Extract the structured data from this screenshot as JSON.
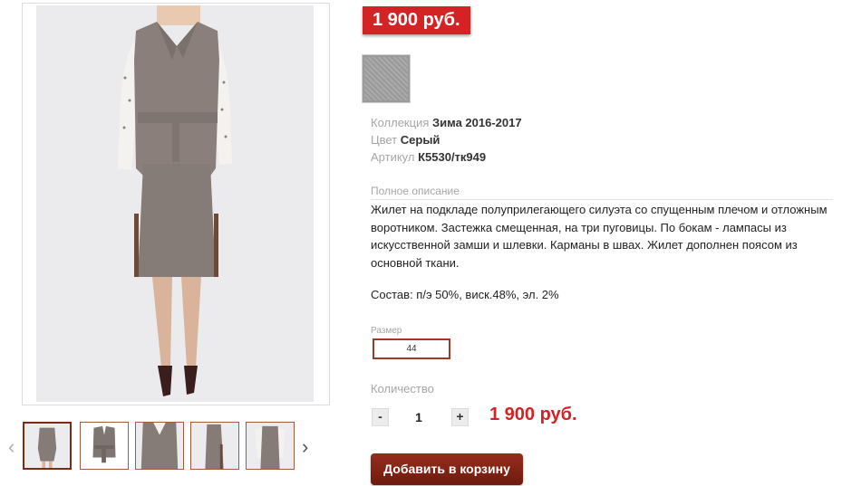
{
  "product": {
    "price_badge": "1 900 руб.",
    "collection": {
      "label": "Коллекция",
      "value": "Зима 2016-2017"
    },
    "color": {
      "label": "Цвет",
      "value": "Серый"
    },
    "article": {
      "label": "Артикул",
      "value": "К5530/тк949"
    },
    "description_label": "Полное описание",
    "description": "Жилет на подкладе полуприлегающего силуэта со спущенным плечом и отложным воротником. Застежка смещенная, на три пуговицы. По бокам - лампасы из искусственной замши и шлевки. Карманы в швах. Жилет дополнен поясом из основной ткани.",
    "composition": "Состав: п/э 50%, виск.48%, эл. 2%",
    "size_label": "Размер",
    "size_value": "44",
    "quantity_label": "Количество",
    "qty_minus": "-",
    "qty_value": "1",
    "qty_plus": "+",
    "total_price": "1 900 руб.",
    "add_to_cart": "Добавить в корзину"
  },
  "gallery": {
    "prev_arrow": "‹",
    "next_arrow": "›",
    "thumbnails": [
      "model-front",
      "vest-flat",
      "model-closeup",
      "model-side",
      "model-back"
    ],
    "active_index": 0
  },
  "colors": {
    "accent_red": "#d32324",
    "button_brown": "#7d2a17",
    "label_gray": "#a6a6a6"
  }
}
